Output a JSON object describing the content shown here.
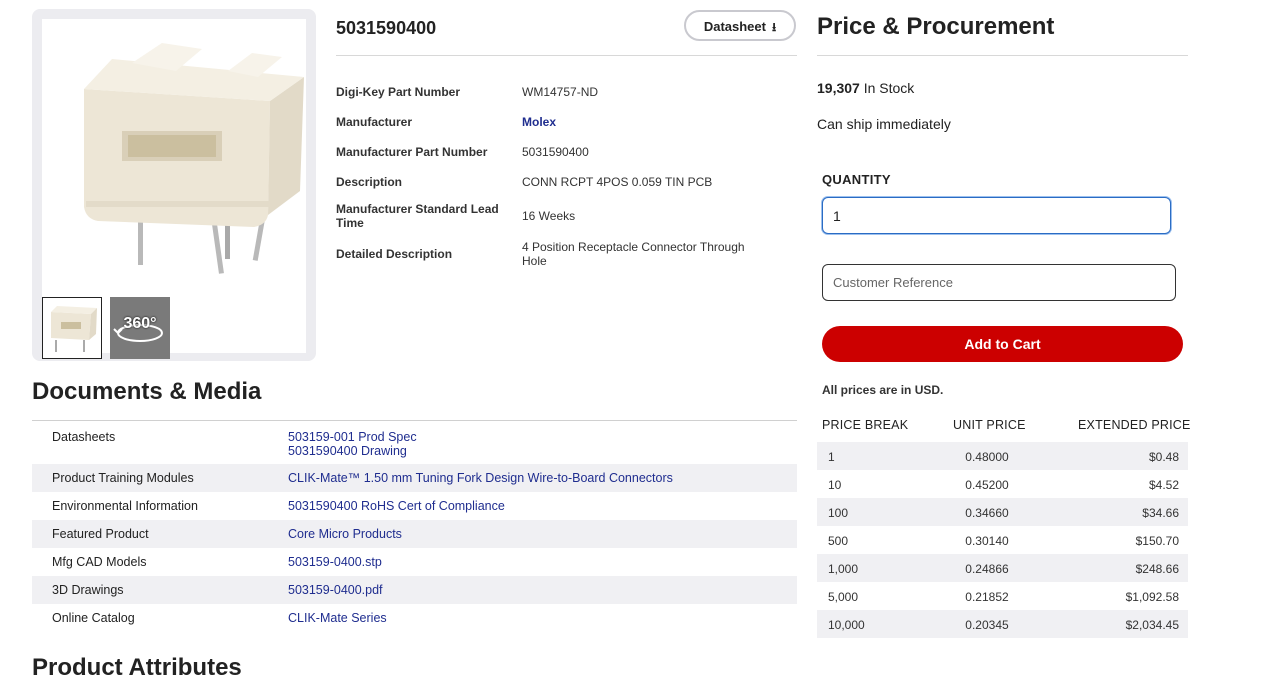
{
  "product": {
    "title": "5031590400",
    "datasheet_label": "Datasheet",
    "thumb_360_label": "360°"
  },
  "details": [
    {
      "label": "Digi-Key Part Number",
      "value": "WM14757-ND"
    },
    {
      "label": "Manufacturer",
      "value": "Molex"
    },
    {
      "label": "Manufacturer Part Number",
      "value": "5031590400"
    },
    {
      "label": "Description",
      "value": "CONN RCPT 4POS 0.059 TIN PCB"
    },
    {
      "label": "Manufacturer Standard Lead Time",
      "value": "16 Weeks"
    },
    {
      "label": "Detailed Description",
      "value": "4 Position Receptacle Connector Through Hole"
    }
  ],
  "documents": {
    "title": "Documents & Media",
    "rows": [
      {
        "label": "Datasheets",
        "links": [
          "503159-001 Prod Spec",
          "5031590400 Drawing"
        ]
      },
      {
        "label": "Product Training Modules",
        "links": [
          "CLIK-Mate™ 1.50 mm Tuning Fork Design Wire-to-Board Connectors"
        ]
      },
      {
        "label": "Environmental Information",
        "links": [
          "5031590400 RoHS Cert of Compliance"
        ]
      },
      {
        "label": "Featured Product",
        "links": [
          "Core Micro Products"
        ]
      },
      {
        "label": "Mfg CAD Models",
        "links": [
          "503159-0400.stp"
        ]
      },
      {
        "label": "3D Drawings",
        "links": [
          "503159-0400.pdf"
        ]
      },
      {
        "label": "Online Catalog",
        "links": [
          "CLIK-Mate Series"
        ]
      }
    ]
  },
  "next_section_title": "Product Attributes",
  "pricing": {
    "title": "Price & Procurement",
    "stock_count": "19,307",
    "stock_text": " In Stock",
    "ship_text": "Can ship immediately",
    "quantity_label": "QUANTITY",
    "quantity_value": "1",
    "customer_ref_placeholder": "Customer Reference",
    "add_to_cart_label": "Add to Cart",
    "currency_note": "All prices are in USD.",
    "columns": [
      "PRICE BREAK",
      "UNIT PRICE",
      "EXTENDED PRICE"
    ],
    "rows": [
      {
        "break": "1",
        "unit": "0.48000",
        "extended": "$0.48"
      },
      {
        "break": "10",
        "unit": "0.45200",
        "extended": "$4.52"
      },
      {
        "break": "100",
        "unit": "0.34660",
        "extended": "$34.66"
      },
      {
        "break": "500",
        "unit": "0.30140",
        "extended": "$150.70"
      },
      {
        "break": "1,000",
        "unit": "0.24866",
        "extended": "$248.66"
      },
      {
        "break": "5,000",
        "unit": "0.21852",
        "extended": "$1,092.58"
      },
      {
        "break": "10,000",
        "unit": "0.20345",
        "extended": "$2,034.45"
      }
    ]
  },
  "colors": {
    "link": "#1f2d8f",
    "cart_button": "#cc0000",
    "accent_border": "#2b6cc4"
  },
  "icons": [
    "download-icon",
    "rotate-360-icon"
  ]
}
